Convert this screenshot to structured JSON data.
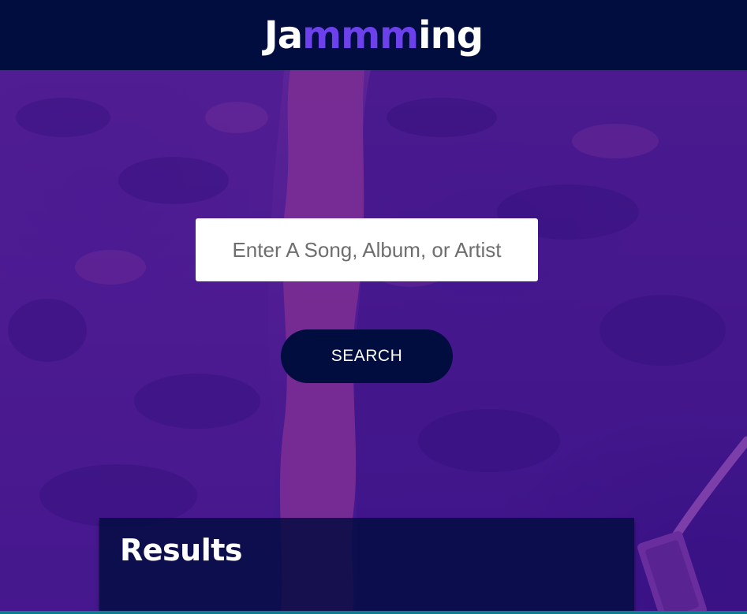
{
  "header": {
    "logo_prefix": "Ja",
    "logo_accent": "mmm",
    "logo_suffix": "ing"
  },
  "search": {
    "placeholder": "Enter A Song, Album, or Artist",
    "value": "",
    "button_label": "SEARCH"
  },
  "results": {
    "title": "Results"
  },
  "colors": {
    "header_bg": "#010c3f",
    "logo_accent": "#6c41ec",
    "button_bg": "#010c3f",
    "background_purple": "#4f1c93",
    "bottom_bar": "#0e7c8c"
  }
}
